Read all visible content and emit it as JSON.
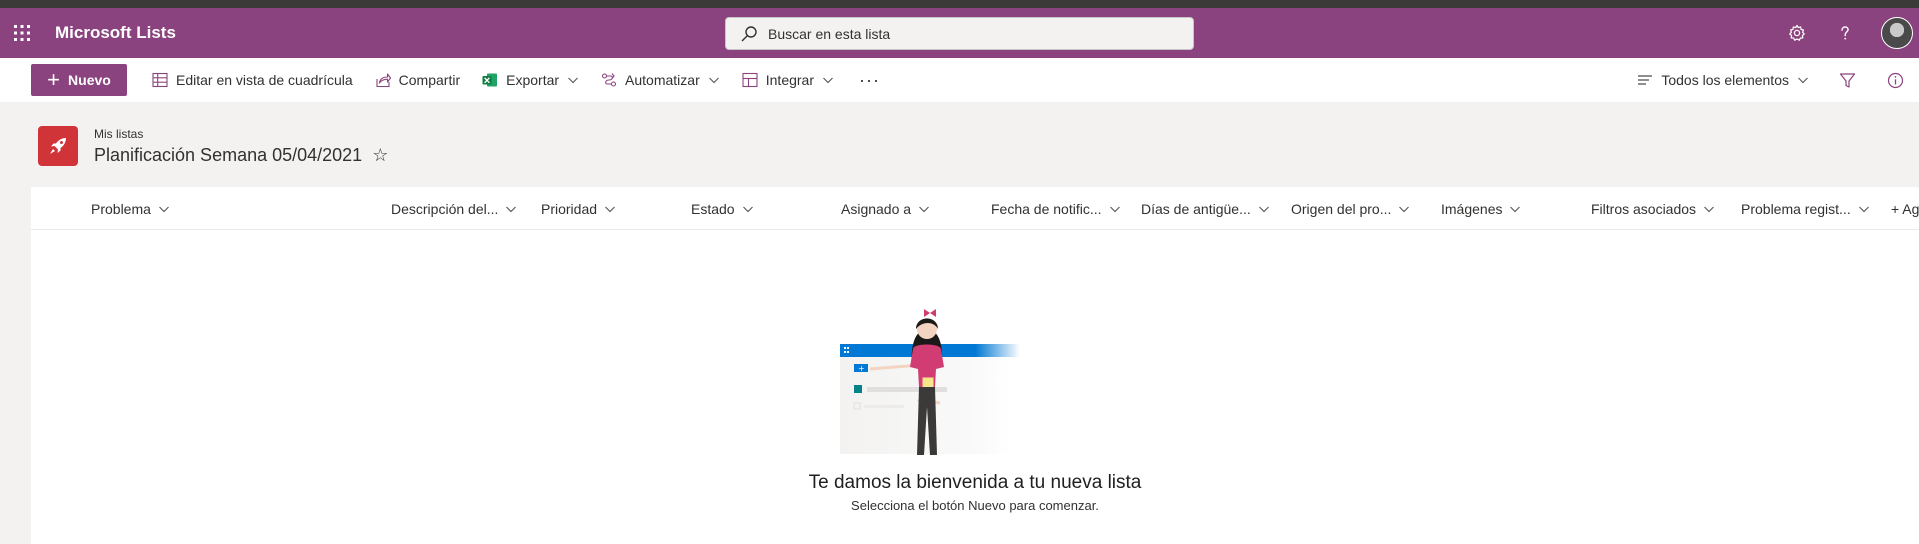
{
  "suitebar": {
    "app_name": "Microsoft Lists",
    "search_placeholder": "Buscar en esta lista",
    "accent": "#8b437f"
  },
  "commandbar": {
    "new_label": "Nuevo",
    "items": [
      {
        "label": "Editar en vista de cuadrícula",
        "icon": "grid-icon"
      },
      {
        "label": "Compartir",
        "icon": "share-icon"
      },
      {
        "label": "Exportar",
        "icon": "excel-icon"
      },
      {
        "label": "Automatizar",
        "icon": "automate-icon"
      },
      {
        "label": "Integrar",
        "icon": "integrate-icon"
      }
    ],
    "more": "···",
    "view_label": "Todos los elementos"
  },
  "list": {
    "breadcrumb": "Mis listas",
    "title": "Planificación Semana 05/04/2021",
    "star": "☆",
    "icon_color": "#d13438"
  },
  "columns": [
    "Problema",
    "Descripción del...",
    "Prioridad",
    "Estado",
    "Asignado a",
    "Fecha de notific...",
    "Días de antigüe...",
    "Origen del pro...",
    "Imágenes",
    "Filtros asociados",
    "Problema regist..."
  ],
  "add_column": "+ Ag",
  "empty_state": {
    "title": "Te damos la bienvenida a tu nueva lista",
    "subtitle": "Selecciona el botón Nuevo para comenzar."
  }
}
